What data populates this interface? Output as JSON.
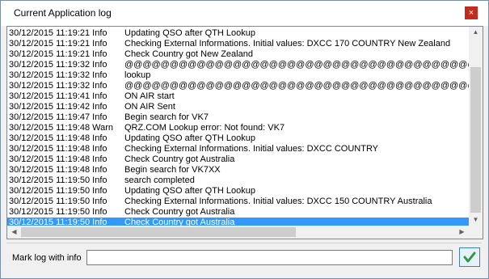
{
  "window": {
    "title": "Current Application log",
    "close_glyph": "×"
  },
  "log": {
    "selected_index": 19,
    "rows": [
      {
        "date": "30/12/2015 11:19:21 Info",
        "message": "Updating QSO after QTH Lookup"
      },
      {
        "date": "30/12/2015 11:19:21 Info",
        "message": "Checking External Informations. Initial values: DXCC 170 COUNTRY New Zealand"
      },
      {
        "date": "30/12/2015 11:19:21 Info",
        "message": "Check Country got New Zealand"
      },
      {
        "date": "30/12/2015 11:19:32 Info",
        "message": "@@@@@@@@@@@@@@@@@@@@@@@@@@@@@@@@@@@@@@@@@@@"
      },
      {
        "date": "30/12/2015 11:19:32 Info",
        "message": "lookup"
      },
      {
        "date": "30/12/2015 11:19:32 Info",
        "message": "@@@@@@@@@@@@@@@@@@@@@@@@@@@@@@@@@@@@@@@@@@@"
      },
      {
        "date": "30/12/2015 11:19:41 Info",
        "message": "ON AIR start"
      },
      {
        "date": "30/12/2015 11:19:42 Info",
        "message": "ON AIR Sent"
      },
      {
        "date": "30/12/2015 11:19:47 Info",
        "message": "Begin search for VK7"
      },
      {
        "date": "30/12/2015 11:19:48 Warn",
        "message": "   QRZ.COM Lookup error: Not found: VK7"
      },
      {
        "date": "30/12/2015 11:19:48 Info",
        "message": "Updating QSO after QTH Lookup"
      },
      {
        "date": "30/12/2015 11:19:48 Info",
        "message": "Checking External Informations. Initial values: DXCC  COUNTRY"
      },
      {
        "date": "30/12/2015 11:19:48 Info",
        "message": "Check Country got Australia"
      },
      {
        "date": "30/12/2015 11:19:48 Info",
        "message": "Begin search for VK7XX"
      },
      {
        "date": "30/12/2015 11:19:50 Info",
        "message": "search completed"
      },
      {
        "date": "30/12/2015 11:19:50 Info",
        "message": "Updating QSO after QTH Lookup"
      },
      {
        "date": "30/12/2015 11:19:50 Info",
        "message": "Checking External Informations. Initial values: DXCC 150 COUNTRY Australia"
      },
      {
        "date": "30/12/2015 11:19:50 Info",
        "message": "Check Country got Australia"
      },
      {
        "date": "30/12/2015 11:19:50 Info",
        "message": "Check Country got Australia"
      }
    ]
  },
  "mark": {
    "label": "Mark log with info",
    "value": "",
    "placeholder": ""
  },
  "confirm_button": {
    "icon": "checkmark-icon"
  },
  "colors": {
    "selection": "#3399ff",
    "close": "#c42b1c",
    "check": "#2e9b3a"
  }
}
